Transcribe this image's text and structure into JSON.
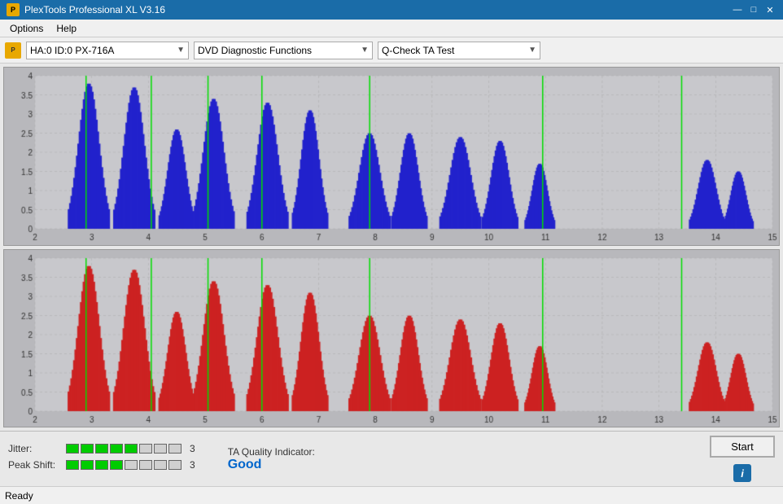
{
  "titleBar": {
    "title": "PlexTools Professional XL V3.16",
    "icon": "P",
    "minimize": "—",
    "maximize": "□",
    "close": "✕"
  },
  "menuBar": {
    "items": [
      "Options",
      "Help"
    ]
  },
  "toolbar": {
    "driveLabel": "HA:0 ID:0  PX-716A",
    "functionLabel": "DVD Diagnostic Functions",
    "testLabel": "Q-Check TA Test"
  },
  "charts": {
    "top": {
      "color": "#0000cc",
      "xLabels": [
        2,
        3,
        4,
        5,
        6,
        7,
        8,
        9,
        10,
        11,
        12,
        13,
        14,
        15
      ],
      "yMax": 4,
      "greenLines": [
        2.9,
        4.05,
        5.05,
        6.0,
        7.9,
        10.95,
        13.4
      ]
    },
    "bottom": {
      "color": "#cc0000",
      "xLabels": [
        2,
        3,
        4,
        5,
        6,
        7,
        8,
        9,
        10,
        11,
        12,
        13,
        14,
        15
      ],
      "yMax": 4,
      "greenLines": [
        2.9,
        4.05,
        5.05,
        6.0,
        7.9,
        10.95,
        13.4
      ]
    }
  },
  "metrics": {
    "jitter": {
      "label": "Jitter:",
      "filledSegs": 5,
      "totalSegs": 8,
      "value": "3"
    },
    "peakShift": {
      "label": "Peak Shift:",
      "filledSegs": 4,
      "totalSegs": 8,
      "value": "3"
    },
    "taQuality": {
      "label": "TA Quality Indicator:",
      "value": "Good"
    }
  },
  "buttons": {
    "start": "Start",
    "info": "i"
  },
  "statusBar": {
    "text": "Ready"
  }
}
